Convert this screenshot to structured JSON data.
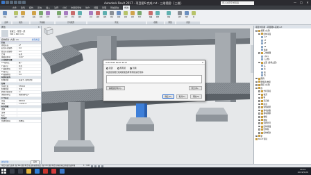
{
  "window": {
    "title": "Autodesk Revit 2017 -  项目图6-完成.rvt - 三维视图: {三维}",
    "search_placeholder": "键入关键字或短语",
    "controls": [
      "—",
      "□",
      "✕"
    ]
  },
  "ribbon": {
    "tabs": [
      "文件",
      "建筑",
      "结构",
      "系统",
      "插入",
      "注释",
      "分析",
      "体量和场地",
      "协作",
      "视图",
      "管理",
      "附加模块",
      "修改"
    ],
    "active_tab": "修改",
    "groups": [
      {
        "label": "选择",
        "buttons": [
          "修改"
        ]
      },
      {
        "label": "属性",
        "buttons": [
          "属性",
          "类型"
        ]
      },
      {
        "label": "剪贴板",
        "buttons": [
          "粘贴",
          "复制",
          "剪切"
        ]
      },
      {
        "label": "几何图形",
        "buttons": [
          "连接",
          "剪切",
          "拆分",
          "填色"
        ]
      },
      {
        "label": "修改",
        "buttons": [
          "对齐",
          "偏移",
          "镜像",
          "移动",
          "复制",
          "旋转",
          "修剪",
          "阵列"
        ]
      },
      {
        "label": "视图",
        "buttons": [
          "隐藏",
          "替换"
        ]
      },
      {
        "label": "测量",
        "buttons": [
          "测量"
        ]
      },
      {
        "label": "创建",
        "buttons": [
          "部件",
          "零件",
          "组"
        ]
      }
    ],
    "context_label": "修改 | 选择多个"
  },
  "properties": {
    "header": "属性",
    "type_name": "混凝土 - 矩形 - 梁",
    "type_sub": "300 x 600 mm",
    "selector": "结构框架 (大梁) (4)",
    "edit_type": "编辑类型",
    "rows": [
      {
        "k": "约束",
        "v": "",
        "cat": true
      },
      {
        "k": "参照标高",
        "v": "1F"
      },
      {
        "k": "起点标高偏移",
        "v": "0.0"
      },
      {
        "k": "终点标高偏移",
        "v": "0.0"
      },
      {
        "k": "方向",
        "v": "标准"
      },
      {
        "k": "横截面旋转",
        "v": "0.00°"
      },
      {
        "k": "几何图形位置",
        "v": "",
        "cat": true
      },
      {
        "k": "YZ 轴对正",
        "v": "统一"
      },
      {
        "k": "Y 轴对正",
        "v": "原点"
      },
      {
        "k": "Y 轴偏移值",
        "v": "0.0"
      },
      {
        "k": "Z 轴对正",
        "v": "顶"
      },
      {
        "k": "Z 轴偏移值",
        "v": "0.0"
      },
      {
        "k": "材质和装饰",
        "v": "",
        "cat": true
      },
      {
        "k": "结构材质",
        "v": "混凝土, 现场浇注"
      },
      {
        "k": "结构",
        "v": "",
        "cat": true
      },
      {
        "k": "剪切长度",
        "v": "5700.0"
      },
      {
        "k": "结构用途",
        "v": "大梁"
      },
      {
        "k": "启用分析模型",
        "v": "☑"
      },
      {
        "k": "钢筋保护层",
        "v": "钢筋保护层 1"
      },
      {
        "k": "尺寸标注",
        "v": "",
        "cat": true
      },
      {
        "k": "长度",
        "v": "6000.0"
      },
      {
        "k": "体积",
        "v": "1.026 m³"
      },
      {
        "k": "标识数据",
        "v": "",
        "cat": true
      },
      {
        "k": "图像",
        "v": ""
      },
      {
        "k": "注释",
        "v": ""
      },
      {
        "k": "标记",
        "v": ""
      },
      {
        "k": "阶段化",
        "v": "",
        "cat": true
      },
      {
        "k": "创建的阶段",
        "v": "新构造"
      }
    ],
    "help_link": "属性帮助",
    "apply": "应用"
  },
  "dialog": {
    "title": "Autodesk Revit 2017",
    "radio_new": "新建",
    "radio_existing": "现有组",
    "radio_replace": "替换",
    "message": "将选定的图元组成组或选择现有组进行替换:",
    "btn_group_name": "编辑组名称(C)...",
    "btn_browse": "浏览(B)...",
    "btn_ok": "确定(O)",
    "btn_cancel": "取消(C)",
    "btn_help": "帮助(H)"
  },
  "browser": {
    "header": "项目浏览器 - 项目图6-完成.rvt",
    "nodes": [
      {
        "t": "视图 (全部)",
        "lvl": 0,
        "exp": "-"
      },
      {
        "t": "结构平面",
        "lvl": 1,
        "exp": "-"
      },
      {
        "t": "-1F",
        "lvl": 2
      },
      {
        "t": "1F",
        "lvl": 2
      },
      {
        "t": "2F",
        "lvl": 2
      },
      {
        "t": "3F",
        "lvl": 2
      },
      {
        "t": "场地",
        "lvl": 2
      },
      {
        "t": "三维视图",
        "lvl": 1,
        "exp": "-"
      },
      {
        "t": "{3D}",
        "lvl": 2
      },
      {
        "t": "{三维}",
        "lvl": 2
      },
      {
        "t": "立面 (建筑立面)",
        "lvl": 1,
        "exp": "-"
      },
      {
        "t": "东",
        "lvl": 2
      },
      {
        "t": "北",
        "lvl": 2
      },
      {
        "t": "南",
        "lvl": 2
      },
      {
        "t": "西",
        "lvl": 2
      },
      {
        "t": "图例",
        "lvl": 0,
        "exp": "+"
      },
      {
        "t": "明细表/数量",
        "lvl": 0,
        "exp": "+"
      },
      {
        "t": "图纸 (全部)",
        "lvl": 0,
        "exp": "+"
      },
      {
        "t": "族",
        "lvl": 0,
        "exp": "-"
      },
      {
        "t": "分析链接",
        "lvl": 1,
        "exp": "+"
      },
      {
        "t": "坡道",
        "lvl": 1,
        "exp": "+"
      },
      {
        "t": "墙",
        "lvl": 1,
        "exp": "+"
      },
      {
        "t": "天花板",
        "lvl": 1,
        "exp": "+"
      },
      {
        "t": "屋顶",
        "lvl": 1,
        "exp": "+"
      },
      {
        "t": "常规模型",
        "lvl": 1,
        "exp": "+"
      },
      {
        "t": "幕墙嵌板",
        "lvl": 1,
        "exp": "+"
      },
      {
        "t": "幕墙竖梃",
        "lvl": 1,
        "exp": "+"
      },
      {
        "t": "楼板",
        "lvl": 1,
        "exp": "+"
      },
      {
        "t": "楼梯",
        "lvl": 1,
        "exp": "+"
      },
      {
        "t": "注释符号",
        "lvl": 1,
        "exp": "+"
      },
      {
        "t": "结构基础",
        "lvl": 1,
        "exp": "+"
      },
      {
        "t": "结构柱",
        "lvl": 1,
        "exp": "+"
      },
      {
        "t": "结构框架",
        "lvl": 1,
        "exp": "+"
      },
      {
        "t": "组",
        "lvl": 0,
        "exp": "+"
      },
      {
        "t": "Revit 链接",
        "lvl": 0
      }
    ]
  },
  "status": {
    "text": "单击可进行选择; 按 Tab 键并单击可选择其他项目; 按 Ctrl 键并单击可将新项目添加到选择集",
    "scale": "1 : 100"
  },
  "taskbar": {
    "time": "20:01",
    "date": "2019/5/29"
  },
  "colors": {
    "accent": "#2f6fd0",
    "concrete": "#8e949a",
    "highlight": "#3d7fd9"
  }
}
